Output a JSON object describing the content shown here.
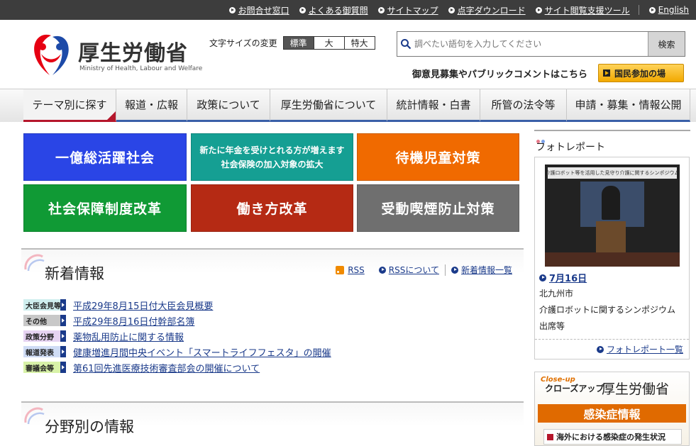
{
  "topbar": {
    "links": [
      "お問合せ窓口",
      "よくある御質問",
      "サイトマップ",
      "点字ダウンロード",
      "サイト閲覧支援ツール",
      "English"
    ]
  },
  "header": {
    "logo_jp": "厚生労働省",
    "logo_en": "Ministry of Health, Labour and Welfare",
    "fontsize_label": "文字サイズの変更",
    "fontsize_options": [
      "標準",
      "大",
      "特大"
    ],
    "search_placeholder": "調べたい語句を入力してください",
    "search_button": "検索",
    "pubcomment_text": "御意見募集やパブリックコメントはこちら",
    "kokumin_button": "国民参加の場"
  },
  "nav": {
    "items": [
      "テーマ別に探す",
      "報道・広報",
      "政策について",
      "厚生労働省について",
      "統計情報・白書",
      "所管の法令等",
      "申請・募集・情報公開"
    ]
  },
  "tiles": [
    {
      "text": "一億総活躍社会",
      "color": "#2a45e6"
    },
    {
      "line1": "新たに年金を受けとれる方が増えます",
      "line2": "社会保険の加入対象の拡大",
      "color": "#159f93"
    },
    {
      "text": "待機児童対策",
      "color": "#f06a00"
    },
    {
      "text": "社会保障制度改革",
      "color": "#109a35"
    },
    {
      "text": "働き方改革",
      "color": "#b52a14"
    },
    {
      "text": "受動喫煙防止対策",
      "color": "#6f6f6f"
    }
  ],
  "news": {
    "title": "新着情報",
    "rss_label": "RSS",
    "rss_about": "RSSについて",
    "list_link": "新着情報一覧",
    "items": [
      {
        "badge": "大臣会見等",
        "badge_color": "#cfeeee",
        "text": "平成29年8月15日付大臣会見概要"
      },
      {
        "badge": "その他",
        "badge_color": "#c8c8c8",
        "text": "平成29年8月16日付幹部名簿"
      },
      {
        "badge": "政策分野",
        "badge_color": "#e6d3f2",
        "text": "薬物乱用防止に関する情報"
      },
      {
        "badge": "報道発表",
        "badge_color": "#cfdcf5",
        "text": "健康増進月間中央イベント「スマートライフフェスタ」の開催"
      },
      {
        "badge": "審議会等",
        "badge_color": "#d8f2a8",
        "text": "第61回先進医療技術審査部会の開催について"
      }
    ]
  },
  "fields": {
    "title": "分野別の情報"
  },
  "photo_report": {
    "title": "フォトレポート",
    "banner": "介護ロボット等を活用した見守り介護に関するシンポジウム",
    "date": "7月16日",
    "desc_lines": [
      "北九州市",
      "介護ロボットに関するシンポジウム",
      "出席等"
    ],
    "more_link": "フォトレポート一覧"
  },
  "closeup": {
    "en": "Close-up",
    "jp": "クローズアップ",
    "org": "厚生労働省",
    "bar": "感染症情報",
    "item": "海外における感染症の発生状況"
  }
}
